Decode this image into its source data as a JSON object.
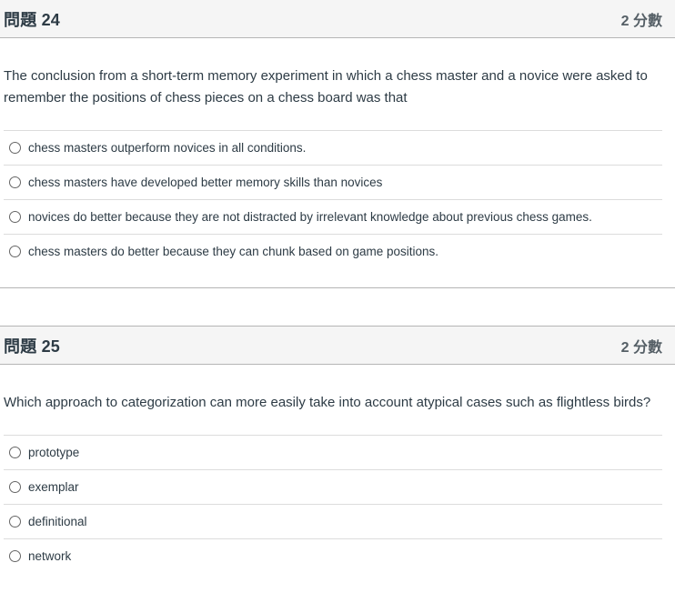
{
  "questions": [
    {
      "title": "問題 24",
      "points": "2 分數",
      "text": "The conclusion from a short-term memory experiment in which a chess master and a novice were asked to remember the positions of chess pieces on a chess board was that",
      "answers": [
        "chess masters outperform novices in all conditions.",
        "chess masters have developed better memory skills than novices",
        "novices do better because they are not distracted by irrelevant knowledge about previous chess games.",
        "chess masters do better because they can chunk based on game positions."
      ]
    },
    {
      "title": "問題 25",
      "points": "2 分數",
      "text": "Which approach to categorization can more easily take into account atypical cases such as flightless birds?",
      "answers": [
        "prototype",
        "exemplar",
        "definitional",
        "network"
      ]
    }
  ]
}
